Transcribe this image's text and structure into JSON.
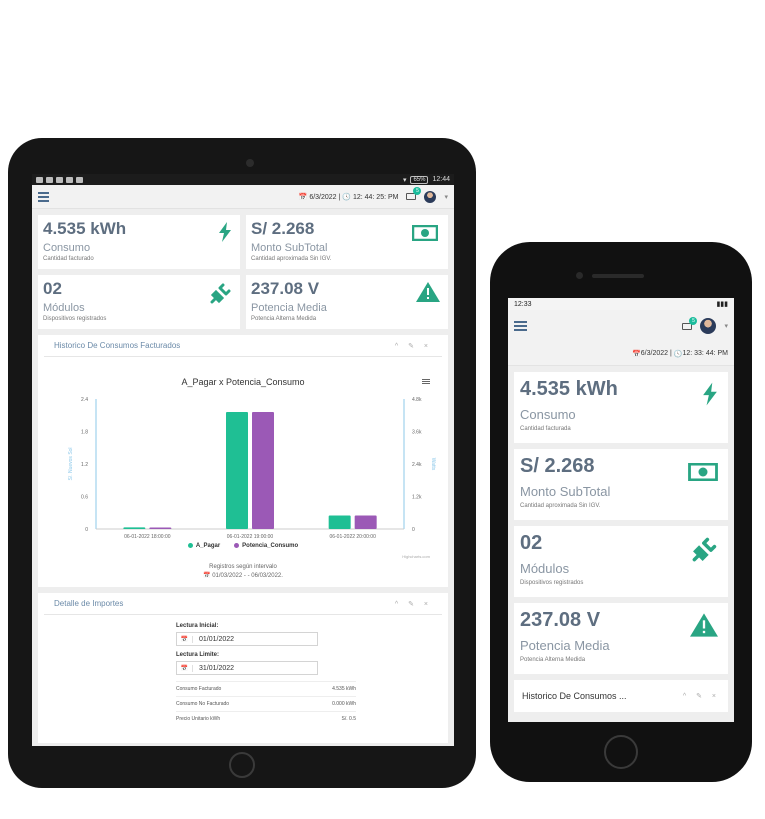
{
  "tablet": {
    "status_battery": "65%",
    "status_time": "12:44",
    "topbar": {
      "date": "6/3/2022",
      "separator": "|",
      "time": "12: 44: 25: PM",
      "mail_count": "5"
    },
    "cards": [
      {
        "value": "4.535 kWh",
        "name": "Consumo",
        "sub": "Cantidad facturado",
        "icon": "lightning-icon"
      },
      {
        "value": "S/ 2.268",
        "name": "Monto SubTotal",
        "sub": "Cantidad aproximada Sin IGV.",
        "icon": "banknote-icon"
      },
      {
        "value": "02",
        "name": "Módulos",
        "sub": "Dispositivos registrados",
        "icon": "plug-icon"
      },
      {
        "value": "237.08 V",
        "name": "Potencia Media",
        "sub": "Potencia Alterna Medida",
        "icon": "warning-icon"
      }
    ],
    "history_panel": {
      "title": "Historico De Consumos Facturados",
      "tools": "^ ✎ ×"
    },
    "details_panel": {
      "title": "Detalle de Importes",
      "tools": "^ ✎ ×",
      "lectura_inicial_label": "Lectura Inicial:",
      "lectura_inicial_value": "01/01/2022",
      "lectura_limite_label": "Lectura Limite:",
      "lectura_limite_value": "31/01/2022",
      "rows": [
        {
          "label": "Consumo Facturado",
          "value": "4.535 kWh"
        },
        {
          "label": "Consumo No Facturado",
          "value": "0.000 kWh"
        },
        {
          "label": "Precio Unitario kWh",
          "value": "S/. 0.5"
        }
      ]
    }
  },
  "phone": {
    "status_time": "12:33",
    "mail_count": "5",
    "date": "6/3/2022",
    "separator": "|",
    "time": "12: 33: 44: PM",
    "cards": [
      {
        "value": "4.535 kWh",
        "name": "Consumo",
        "sub": "Cantidad facturada",
        "icon": "lightning-icon"
      },
      {
        "value": "S/ 2.268",
        "name": "Monto SubTotal",
        "sub": "Cantidad aproximada Sin IGV.",
        "icon": "banknote-icon"
      },
      {
        "value": "02",
        "name": "Módulos",
        "sub": "Dispositivos registrados",
        "icon": "plug-icon"
      },
      {
        "value": "237.08 V",
        "name": "Potencia Media",
        "sub": "Potencia Alterna Medida",
        "icon": "warning-icon"
      }
    ],
    "history_panel": {
      "title": "Historico De Consumos ...",
      "tools": "^ ✎ ×"
    }
  },
  "colors": {
    "accent": "#1abc9c",
    "series_a": "#1fbf94",
    "series_b": "#9b59b6",
    "value_text": "#5e6e80",
    "icon": "#29a583"
  },
  "chart_data": {
    "type": "bar",
    "title": "A_Pagar x Potencia_Consumo",
    "categories": [
      "06-01-2022 18:00:00",
      "06-01-2022 19:00:00",
      "06-01-2022 20:00:00"
    ],
    "series": [
      {
        "name": "A_Pagar",
        "axis": "left",
        "values": [
          0.03,
          2.16,
          0.25
        ]
      },
      {
        "name": "Potencia_Consumo",
        "axis": "right",
        "values": [
          40,
          4320,
          500
        ]
      }
    ],
    "ylabel": "S/. Nuevos Sol",
    "ylabel_right": "Watts",
    "ylim": [
      0,
      2.4
    ],
    "ylim_right": [
      0,
      4800
    ],
    "yticks": [
      "0",
      "0.6",
      "1.2",
      "1.8",
      "2.4"
    ],
    "yticks_right": [
      "0",
      "1.2k",
      "2.4k",
      "3.6k",
      "4.8k"
    ],
    "subtitle_line1": "Registros según intervalo",
    "subtitle_line2": "01/03/2022 - - 06/03/2022.",
    "credits": "Highcharts.com",
    "legend_position": "bottom"
  }
}
